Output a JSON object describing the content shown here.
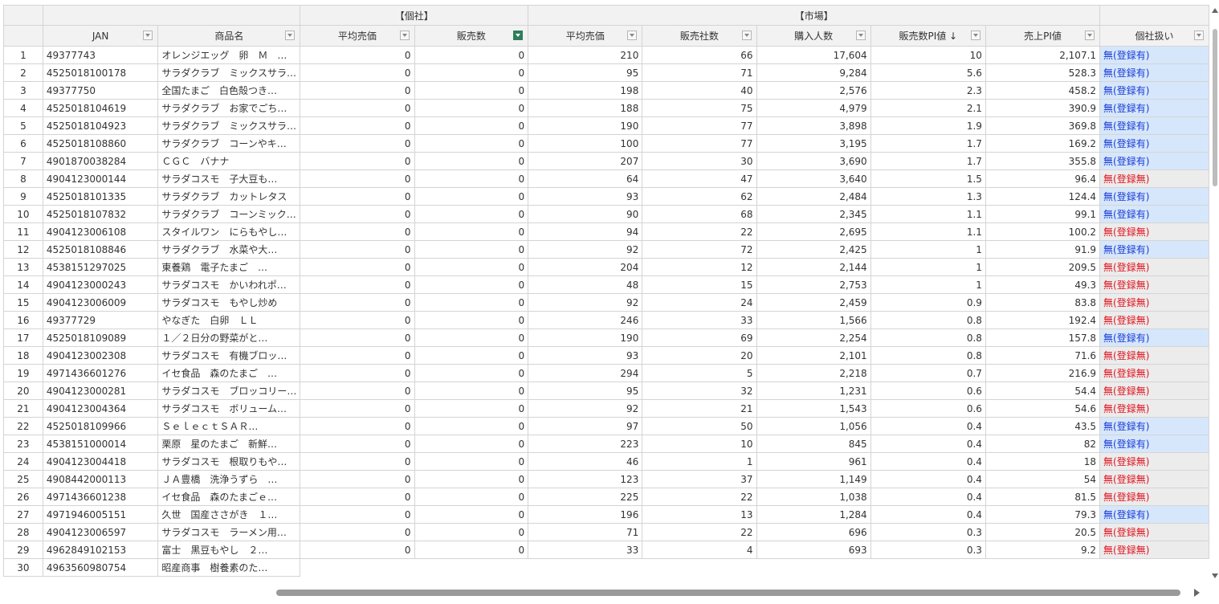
{
  "groups": {
    "kosha": "【個社】",
    "market": "【市場】"
  },
  "columns": [
    "JAN",
    "商品名",
    "平均売価",
    "販売数",
    "平均売価",
    "販売社数",
    "購入人数",
    "販売数PI値 ↓",
    "売上PI値",
    "個社扱い"
  ],
  "flags": {
    "registered": "無(登録有)",
    "none": "無(登録無)"
  },
  "rows": [
    {
      "n": "1",
      "jan": "49377743",
      "name": "オレンジエッグ　卵　Ｍ　…",
      "p1": "0",
      "s1": "0",
      "p2": "210",
      "c": "66",
      "b": "17,604",
      "pi": "10",
      "spi": "2,107.1",
      "flag": "無(登録有)",
      "reg": true
    },
    {
      "n": "2",
      "jan": "4525018100178",
      "name": "サラダクラブ　ミックスサラ…",
      "p1": "0",
      "s1": "0",
      "p2": "95",
      "c": "71",
      "b": "9,284",
      "pi": "5.6",
      "spi": "528.3",
      "flag": "無(登録有)",
      "reg": true
    },
    {
      "n": "3",
      "jan": "49377750",
      "name": "全国たまご　白色殻つき…",
      "p1": "0",
      "s1": "0",
      "p2": "198",
      "c": "40",
      "b": "2,576",
      "pi": "2.3",
      "spi": "458.2",
      "flag": "無(登録有)",
      "reg": true
    },
    {
      "n": "4",
      "jan": "4525018104619",
      "name": "サラダクラブ　お家でごち…",
      "p1": "0",
      "s1": "0",
      "p2": "188",
      "c": "75",
      "b": "4,979",
      "pi": "2.1",
      "spi": "390.9",
      "flag": "無(登録有)",
      "reg": true
    },
    {
      "n": "5",
      "jan": "4525018104923",
      "name": "サラダクラブ　ミックスサラ…",
      "p1": "0",
      "s1": "0",
      "p2": "190",
      "c": "77",
      "b": "3,898",
      "pi": "1.9",
      "spi": "369.8",
      "flag": "無(登録有)",
      "reg": true
    },
    {
      "n": "6",
      "jan": "4525018108860",
      "name": "サラダクラブ　コーンやキ…",
      "p1": "0",
      "s1": "0",
      "p2": "100",
      "c": "77",
      "b": "3,195",
      "pi": "1.7",
      "spi": "169.2",
      "flag": "無(登録有)",
      "reg": true
    },
    {
      "n": "7",
      "jan": "4901870038284",
      "name": "ＣＧＣ　バナナ",
      "p1": "0",
      "s1": "0",
      "p2": "207",
      "c": "30",
      "b": "3,690",
      "pi": "1.7",
      "spi": "355.8",
      "flag": "無(登録有)",
      "reg": true
    },
    {
      "n": "8",
      "jan": "4904123000144",
      "name": "サラダコスモ　子大豆も…",
      "p1": "0",
      "s1": "0",
      "p2": "64",
      "c": "47",
      "b": "3,640",
      "pi": "1.5",
      "spi": "96.4",
      "flag": "無(登録無)",
      "reg": false
    },
    {
      "n": "9",
      "jan": "4525018101335",
      "name": "サラダクラブ　カットレタス",
      "p1": "0",
      "s1": "0",
      "p2": "93",
      "c": "62",
      "b": "2,484",
      "pi": "1.3",
      "spi": "124.4",
      "flag": "無(登録有)",
      "reg": true
    },
    {
      "n": "10",
      "jan": "4525018107832",
      "name": "サラダクラブ　コーンミック…",
      "p1": "0",
      "s1": "0",
      "p2": "90",
      "c": "68",
      "b": "2,345",
      "pi": "1.1",
      "spi": "99.1",
      "flag": "無(登録有)",
      "reg": true
    },
    {
      "n": "11",
      "jan": "4904123006108",
      "name": "スタイルワン　にらもやし…",
      "p1": "0",
      "s1": "0",
      "p2": "94",
      "c": "22",
      "b": "2,695",
      "pi": "1.1",
      "spi": "100.2",
      "flag": "無(登録無)",
      "reg": false
    },
    {
      "n": "12",
      "jan": "4525018108846",
      "name": "サラダクラブ　水菜や大…",
      "p1": "0",
      "s1": "0",
      "p2": "92",
      "c": "72",
      "b": "2,425",
      "pi": "1",
      "spi": "91.9",
      "flag": "無(登録有)",
      "reg": true
    },
    {
      "n": "13",
      "jan": "4538151297025",
      "name": "東養鶏　電子たまご　…",
      "p1": "0",
      "s1": "0",
      "p2": "204",
      "c": "12",
      "b": "2,144",
      "pi": "1",
      "spi": "209.5",
      "flag": "無(登録無)",
      "reg": false
    },
    {
      "n": "14",
      "jan": "4904123000243",
      "name": "サラダコスモ　かいわれポ…",
      "p1": "0",
      "s1": "0",
      "p2": "48",
      "c": "15",
      "b": "2,753",
      "pi": "1",
      "spi": "49.3",
      "flag": "無(登録無)",
      "reg": false
    },
    {
      "n": "15",
      "jan": "4904123006009",
      "name": "サラダコスモ　もやし炒め",
      "p1": "0",
      "s1": "0",
      "p2": "92",
      "c": "24",
      "b": "2,459",
      "pi": "0.9",
      "spi": "83.8",
      "flag": "無(登録無)",
      "reg": false
    },
    {
      "n": "16",
      "jan": "49377729",
      "name": "やなぎた　白卵　ＬＬ",
      "p1": "0",
      "s1": "0",
      "p2": "246",
      "c": "33",
      "b": "1,566",
      "pi": "0.8",
      "spi": "192.4",
      "flag": "無(登録無)",
      "reg": false
    },
    {
      "n": "17",
      "jan": "4525018109089",
      "name": "１／２日分の野菜がと…",
      "p1": "0",
      "s1": "0",
      "p2": "190",
      "c": "69",
      "b": "2,254",
      "pi": "0.8",
      "spi": "157.8",
      "flag": "無(登録有)",
      "reg": true
    },
    {
      "n": "18",
      "jan": "4904123002308",
      "name": "サラダコスモ　有機ブロッ…",
      "p1": "0",
      "s1": "0",
      "p2": "93",
      "c": "20",
      "b": "2,101",
      "pi": "0.8",
      "spi": "71.6",
      "flag": "無(登録無)",
      "reg": false
    },
    {
      "n": "19",
      "jan": "4971436601276",
      "name": "イセ食品　森のたまご　…",
      "p1": "0",
      "s1": "0",
      "p2": "294",
      "c": "5",
      "b": "2,218",
      "pi": "0.7",
      "spi": "216.9",
      "flag": "無(登録無)",
      "reg": false
    },
    {
      "n": "20",
      "jan": "4904123000281",
      "name": "サラダコスモ　ブロッコリー…",
      "p1": "0",
      "s1": "0",
      "p2": "95",
      "c": "32",
      "b": "1,231",
      "pi": "0.6",
      "spi": "54.4",
      "flag": "無(登録無)",
      "reg": false
    },
    {
      "n": "21",
      "jan": "4904123004364",
      "name": "サラダコスモ　ボリューム…",
      "p1": "0",
      "s1": "0",
      "p2": "92",
      "c": "21",
      "b": "1,543",
      "pi": "0.6",
      "spi": "54.6",
      "flag": "無(登録無)",
      "reg": false
    },
    {
      "n": "22",
      "jan": "4525018109966",
      "name": "ＳｅｌｅｃｔＳＡＲ…",
      "p1": "0",
      "s1": "0",
      "p2": "97",
      "c": "50",
      "b": "1,056",
      "pi": "0.4",
      "spi": "43.5",
      "flag": "無(登録有)",
      "reg": true
    },
    {
      "n": "23",
      "jan": "4538151000014",
      "name": "栗原　星のたまご　新鮮…",
      "p1": "0",
      "s1": "0",
      "p2": "223",
      "c": "10",
      "b": "845",
      "pi": "0.4",
      "spi": "82",
      "flag": "無(登録有)",
      "reg": true
    },
    {
      "n": "24",
      "jan": "4904123004418",
      "name": "サラダコスモ　根取りもや…",
      "p1": "0",
      "s1": "0",
      "p2": "46",
      "c": "1",
      "b": "961",
      "pi": "0.4",
      "spi": "18",
      "flag": "無(登録無)",
      "reg": false
    },
    {
      "n": "25",
      "jan": "4908442000113",
      "name": "ＪＡ豊橋　洗浄うずら　…",
      "p1": "0",
      "s1": "0",
      "p2": "123",
      "c": "37",
      "b": "1,149",
      "pi": "0.4",
      "spi": "54",
      "flag": "無(登録無)",
      "reg": false
    },
    {
      "n": "26",
      "jan": "4971436601238",
      "name": "イセ食品　森のたまごｅ…",
      "p1": "0",
      "s1": "0",
      "p2": "225",
      "c": "22",
      "b": "1,038",
      "pi": "0.4",
      "spi": "81.5",
      "flag": "無(登録無)",
      "reg": false
    },
    {
      "n": "27",
      "jan": "4971946005151",
      "name": "久世　国産ささがき　１…",
      "p1": "0",
      "s1": "0",
      "p2": "196",
      "c": "13",
      "b": "1,284",
      "pi": "0.4",
      "spi": "79.3",
      "flag": "無(登録有)",
      "reg": true
    },
    {
      "n": "28",
      "jan": "4904123006597",
      "name": "サラダコスモ　ラーメン用…",
      "p1": "0",
      "s1": "0",
      "p2": "71",
      "c": "22",
      "b": "696",
      "pi": "0.3",
      "spi": "20.5",
      "flag": "無(登録無)",
      "reg": false
    },
    {
      "n": "29",
      "jan": "4962849102153",
      "name": "富士　黒豆もやし　２…",
      "p1": "0",
      "s1": "0",
      "p2": "33",
      "c": "4",
      "b": "693",
      "pi": "0.3",
      "spi": "9.2",
      "flag": "無(登録無)",
      "reg": false
    },
    {
      "n": "30",
      "jan": "4963560980754",
      "name": "昭産商事　樹養素のた…",
      "p1": "",
      "s1": "",
      "p2": "",
      "c": "",
      "b": "",
      "pi": "",
      "spi": "",
      "flag": "",
      "reg": true
    }
  ]
}
